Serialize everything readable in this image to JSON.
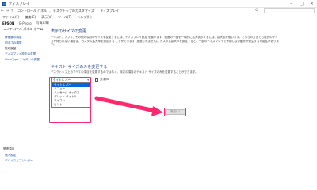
{
  "window": {
    "title": "ディスプレイ"
  },
  "address": {
    "crumbs": [
      "コントロール パネル",
      "デスクトップのカスタマイズ",
      "ディスプレイ"
    ]
  },
  "menu": [
    "ファイル(F)",
    "編集(E)",
    "表示(V)",
    "ツール(T)",
    "ヘルプ(H)"
  ],
  "epson": {
    "brand": "EPSON",
    "app": "E-Photo",
    "item": "写真印刷"
  },
  "sidebar": {
    "header": "コントロール パネル ホーム",
    "links": [
      "解像度の調整",
      "明るさの調整",
      "色の調整",
      "ディスプレイ設定の変更",
      "ClearType テキストの調整"
    ],
    "active_index": 2,
    "bottom_header": "関連項目",
    "bottom_links": [
      "個人設定",
      "デバイスとプリンター"
    ]
  },
  "main": {
    "title": "表示のサイズの変更",
    "paragraph": "テキスト、アプリ、その他の項目のサイズを変更するには、ディスプレイ設定 を使います。画面の一部を一時的に拡大表示するには、拡大鏡を使います。どちらの方法でも目的のサイズが得られない場合は、カスタム拡大率を設定する ことができます (推奨されません)。カスタム拡大率を設定すると、一部のディスプレイで予期しない動作が発生する可能性があります。",
    "subtitle": "テキスト サイズのみを変更する",
    "subparagraph": "デスクトップ上のすべての項目を変更するのではなく、特定の項目のテキスト サイズのみを変更することができます。",
    "dropdown_value": "タイトル バー",
    "size_value": "9",
    "bold_label": "太字(B)",
    "options": [
      "タイトル バー",
      "メニュー",
      "メッセージ ボックス",
      "パレット タイトル",
      "アイコン",
      "ヒント"
    ],
    "selected_option": 0,
    "apply_label": "適用(A)"
  },
  "colors": {
    "highlight": "#ff2a6d",
    "link": "#1a4d9a",
    "heading": "#1e3f8a",
    "selection": "#0a64d8"
  }
}
